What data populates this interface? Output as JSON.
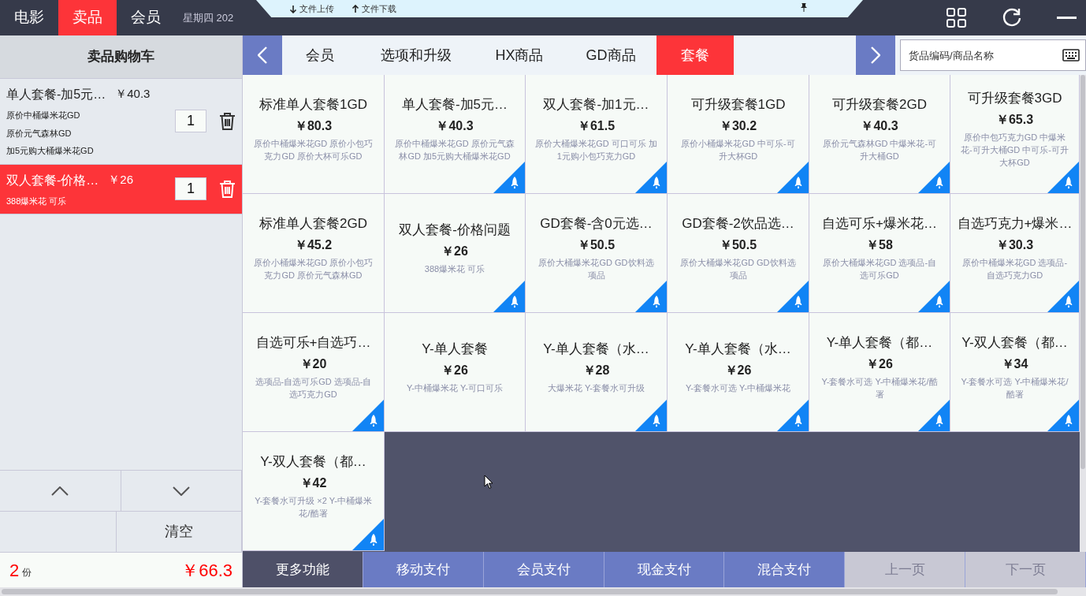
{
  "top_tabs": [
    {
      "label": "电影",
      "selected": false
    },
    {
      "label": "卖品",
      "selected": true
    },
    {
      "label": "会员",
      "selected": false
    }
  ],
  "status_text": "星期四 202",
  "file_panel": {
    "items": [
      {
        "label": "文件上传",
        "kind": "down"
      },
      {
        "label": "文件下载",
        "kind": "up"
      }
    ]
  },
  "cart": {
    "title": "卖品购物车",
    "items": [
      {
        "name": "单人套餐-加5元…",
        "price": "￥40.3",
        "options": [
          "原价中桶爆米花GD",
          "原价元气森林GD",
          "加5元购大桶爆米花GD"
        ],
        "qty": "1",
        "selected": false
      },
      {
        "name": "双人套餐-价格…",
        "price": "￥26",
        "options": [
          "388爆米花  可乐"
        ],
        "qty": "1",
        "selected": true
      }
    ],
    "clear_label": "清空",
    "count": "2",
    "count_unit": "份",
    "total": "￥66.3"
  },
  "categories": [
    {
      "label": "会员",
      "selected": false
    },
    {
      "label": "选项和升级",
      "selected": false
    },
    {
      "label": "HX商品",
      "selected": false
    },
    {
      "label": "GD商品",
      "selected": false
    },
    {
      "label": "套餐",
      "selected": true
    }
  ],
  "search": {
    "placeholder": "货品编码/商品名称"
  },
  "products": [
    {
      "name": "标准单人套餐1GD",
      "price": "￥80.3",
      "desc": "原价中桶爆米花GD 原价小包巧克力GD 原价大杯可乐GD",
      "rocket": false
    },
    {
      "name": "单人套餐-加5元…",
      "price": "￥40.3",
      "desc": "原价中桶爆米花GD 原价元气森林GD 加5元购大桶爆米花GD",
      "rocket": true
    },
    {
      "name": "双人套餐-加1元…",
      "price": "￥61.5",
      "desc": "原价大桶爆米花GD 可口可乐 加1元购小包巧克力GD",
      "rocket": true
    },
    {
      "name": "可升级套餐1GD",
      "price": "￥30.2",
      "desc": "原价小桶爆米花GD 中可乐-可升大杯GD",
      "rocket": true
    },
    {
      "name": "可升级套餐2GD",
      "price": "￥40.3",
      "desc": "原价元气森林GD 中爆米花-可升大桶GD",
      "rocket": true
    },
    {
      "name": "可升级套餐3GD",
      "price": "￥65.3",
      "desc": "原价中包巧克力GD 中爆米花-可升大桶GD 中可乐-可升大杯GD",
      "rocket": true
    },
    {
      "name": "标准单人套餐2GD",
      "price": "￥45.2",
      "desc": "原价小桶爆米花GD 原价小包巧克力GD 原价元气森林GD",
      "rocket": false
    },
    {
      "name": "双人套餐-价格问题",
      "price": "￥26",
      "desc": "388爆米花  可乐",
      "rocket": true
    },
    {
      "name": "GD套餐-含0元选…",
      "price": "￥50.5",
      "desc": "原价大桶爆米花GD GD饮料选项品",
      "rocket": true
    },
    {
      "name": "GD套餐-2饮品选…",
      "price": "￥50.5",
      "desc": "原价大桶爆米花GD GD饮料选项品",
      "rocket": true
    },
    {
      "name": "自选可乐+爆米花…",
      "price": "￥58",
      "desc": "原价大桶爆米花GD 选项品-自选可乐GD",
      "rocket": true
    },
    {
      "name": "自选巧克力+爆米…",
      "price": "￥30.3",
      "desc": "原价中桶爆米花GD 选项品-自选巧克力GD",
      "rocket": true
    },
    {
      "name": "自选可乐+自选巧…",
      "price": "￥20",
      "desc": "选项品-自选可乐GD 选项品-自选巧克力GD",
      "rocket": true
    },
    {
      "name": "Y-单人套餐",
      "price": "￥26",
      "desc": "Y-中桶爆米花 Y-可口可乐",
      "rocket": false
    },
    {
      "name": "Y-单人套餐（水…",
      "price": "￥28",
      "desc": "大爆米花 Y-套餐水可升级",
      "rocket": true
    },
    {
      "name": "Y-单人套餐（水…",
      "price": "￥26",
      "desc": "Y-套餐水可选 Y-中桶爆米花",
      "rocket": true
    },
    {
      "name": "Y-单人套餐（都…",
      "price": "￥26",
      "desc": "Y-套餐水可选 Y-中桶爆米花/酷署",
      "rocket": true
    },
    {
      "name": "Y-双人套餐（都…",
      "price": "￥34",
      "desc": "Y-套餐水可选 Y-中桶爆米花/酷署",
      "rocket": true
    },
    {
      "name": "Y-双人套餐（都…",
      "price": "￥42",
      "desc": "Y-套餐水可升级 ×2 Y-中桶爆米花/酷署",
      "rocket": true
    }
  ],
  "actions": [
    {
      "label": "更多功能",
      "kind": "more",
      "disabled": false
    },
    {
      "label": "移动支付",
      "kind": "pay",
      "disabled": false
    },
    {
      "label": "会员支付",
      "kind": "pay",
      "disabled": false
    },
    {
      "label": "现金支付",
      "kind": "pay",
      "disabled": false
    },
    {
      "label": "混合支付",
      "kind": "pay",
      "disabled": false
    },
    {
      "label": "上一页",
      "kind": "pay",
      "disabled": true
    },
    {
      "label": "下一页",
      "kind": "pay",
      "disabled": true
    }
  ]
}
